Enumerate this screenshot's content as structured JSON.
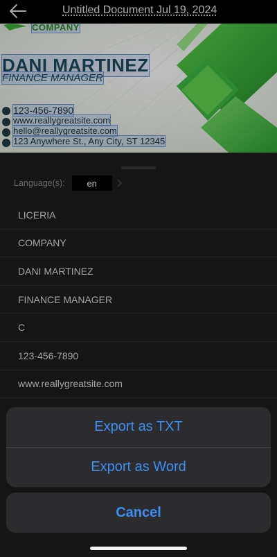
{
  "header": {
    "back_icon": "arrow-left-icon",
    "title": "Untitled Document Jul 19, 2024"
  },
  "card_preview": {
    "company": "COMPANY",
    "name": "DANI MARTINEZ",
    "role": "FINANCE MANAGER",
    "phone": "123-456-7890",
    "website": "www.reallygreatsite.com",
    "email": "hello@reallygreatsite.com",
    "address": "123 Anywhere St., Any City, ST 12345",
    "accent_color": "#3db23a"
  },
  "language": {
    "label": "Language(s):",
    "value": "en",
    "chevron_icon": "chevron-right-icon"
  },
  "recognized_text": [
    "LICERIA",
    "COMPANY",
    "DANI MARTINEZ",
    "FINANCE MANAGER",
    "C",
    "123-456-7890",
    "www.reallygreatsite.com"
  ],
  "action_sheet": {
    "export_txt": "Export as TXT",
    "export_word": "Export as Word",
    "cancel": "Cancel",
    "accent_color": "#3b8ff5"
  }
}
